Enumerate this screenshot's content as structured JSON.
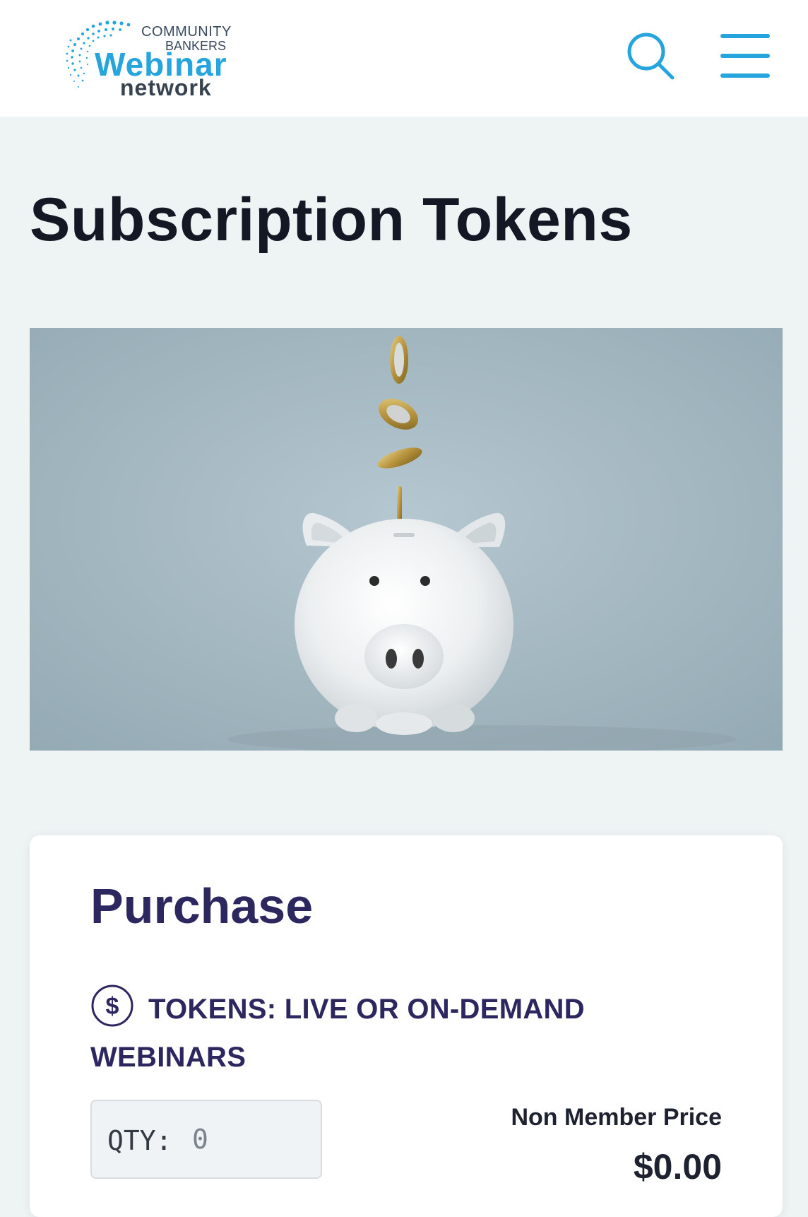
{
  "header": {
    "logo": {
      "line1": "COMMUNITY",
      "line2": "BANKERS",
      "line3": "Webinar",
      "line4": "network"
    },
    "search_icon": "search-icon",
    "menu_icon": "hamburger-menu-icon",
    "accent_color": "#25a4dd"
  },
  "page": {
    "title": "Subscription Tokens",
    "hero_image": "piggy-bank-with-falling-coins-image"
  },
  "purchase": {
    "title": "Purchase",
    "product_icon": "dollar-circle-icon",
    "product_name": "TOKENS: LIVE OR ON-DEMAND WEBINARS",
    "qty_label": "QTY:",
    "qty_placeholder": "0",
    "price_label": "Non Member Price",
    "price_value": "$0.00"
  },
  "colors": {
    "page_background": "#eef3f4",
    "title_text": "#141824",
    "card_heading": "#2d2760"
  }
}
